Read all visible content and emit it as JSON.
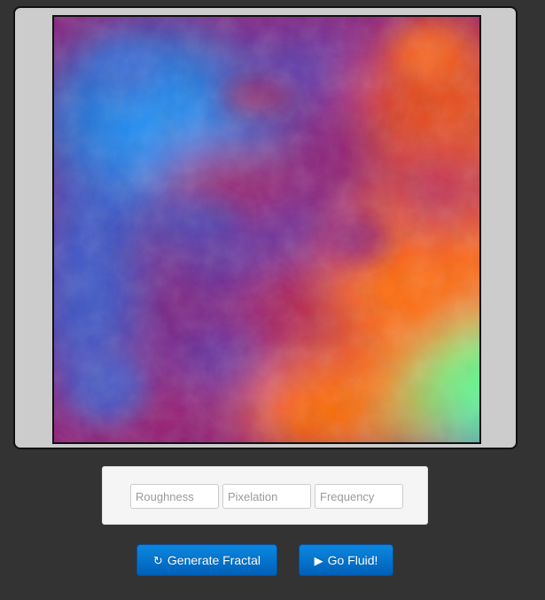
{
  "canvas": {
    "colors": {
      "base": "#8a1f7a",
      "blue": "#1a8cf0",
      "purple": "#5a40b0",
      "red": "#c8154a",
      "orange": "#ff6a00",
      "green": "#60ff90"
    }
  },
  "controls": {
    "roughness_placeholder": "Roughness",
    "pixelation_placeholder": "Pixelation",
    "frequency_placeholder": "Frequency"
  },
  "buttons": {
    "generate_icon": "refresh-icon",
    "generate_label": "Generate Fractal",
    "fluid_icon": "play-icon",
    "fluid_label": "Go Fluid!"
  }
}
